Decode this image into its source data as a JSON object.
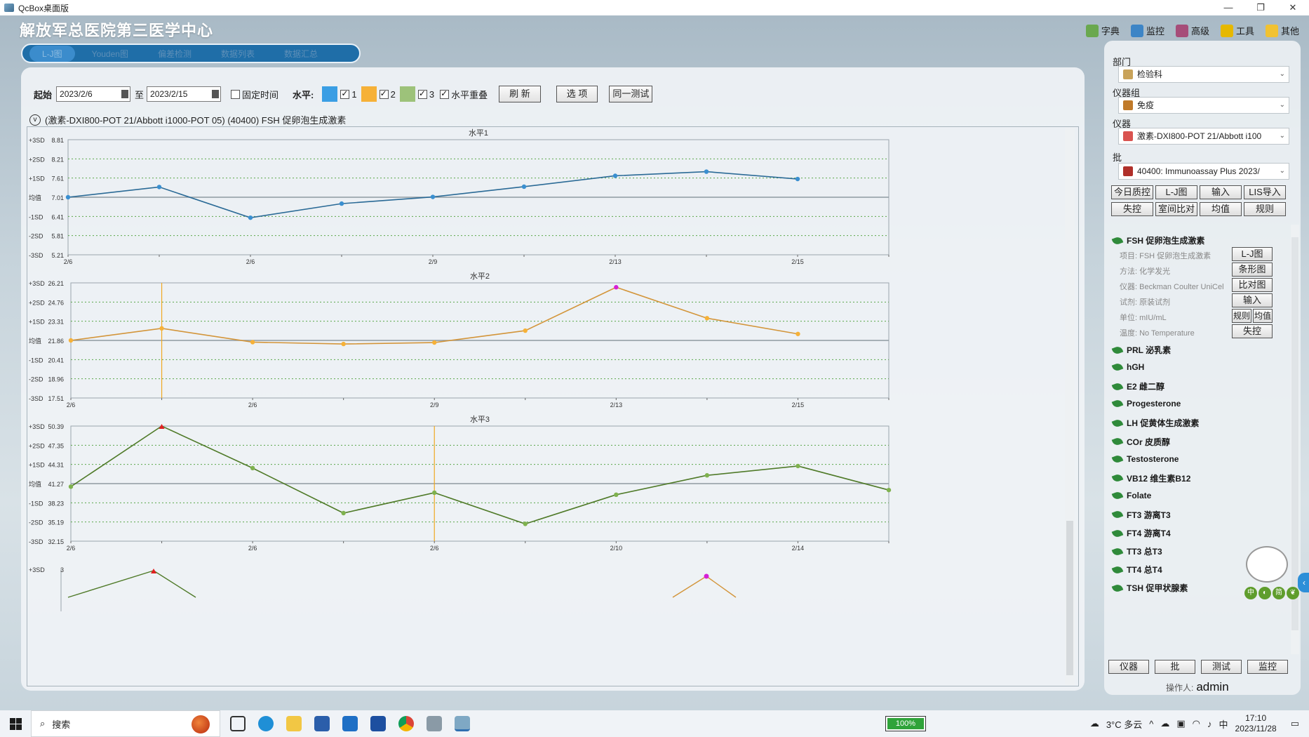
{
  "window": {
    "title": "QcBox桌面版",
    "controls": [
      "—",
      "❐",
      "✕"
    ]
  },
  "header": {
    "hospital": "解放军总医院第三医学中心",
    "tools": [
      {
        "label": "字典",
        "icon": "dictionary-icon",
        "color": "#6aa84f"
      },
      {
        "label": "监控",
        "icon": "monitor-icon",
        "color": "#3d85c6"
      },
      {
        "label": "高级",
        "icon": "advanced-icon",
        "color": "#a64d79"
      },
      {
        "label": "工具",
        "icon": "tools-icon",
        "color": "#e6b800"
      },
      {
        "label": "其他",
        "icon": "other-icon",
        "color": "#f1c232"
      }
    ],
    "nav_tabs": [
      "L-J图",
      "Youden图",
      "偏差检测",
      "数据列表",
      "数据汇总"
    ]
  },
  "filter": {
    "start_label": "起始",
    "start_date": "2023/2/6",
    "to_label": "至",
    "end_date": "2023/2/15",
    "fixed_time_label": "固定时间",
    "fixed_time_checked": false,
    "level_label": "水平:",
    "levels": [
      {
        "label": "1",
        "color": "#3a9ee4",
        "checked": true
      },
      {
        "label": "2",
        "color": "#f6b138",
        "checked": true
      },
      {
        "label": "3",
        "color": "#9dc27a",
        "checked": true
      }
    ],
    "overlap_label": "水平重叠",
    "overlap_checked": true,
    "refresh_label": "刷 新",
    "options_label": "选 项",
    "same_test_label": "同一测试"
  },
  "chart_header": {
    "toggle": "v",
    "text": "(激素-DXI800-POT 21/Abbott i1000-POT 05)  (40400)  FSH 促卵泡生成激素"
  },
  "chart_data": [
    {
      "type": "line",
      "title": "水平1",
      "color": "#2a6a96",
      "sd_labels": [
        "+3SD",
        "+2SD",
        "+1SD",
        "均值",
        "-1SD",
        "-2SD",
        "-3SD"
      ],
      "y_ticks": [
        "8.81",
        "8.21",
        "7.61",
        "7.01",
        "6.41",
        "5.81",
        "5.21"
      ],
      "ylim": [
        5.21,
        8.81
      ],
      "x_labels": [
        "2/6",
        "2/6",
        "2/9",
        "2/13",
        "2/15"
      ],
      "values": [
        7.01,
        7.33,
        6.37,
        6.81,
        7.02,
        7.34,
        7.68,
        7.81,
        7.58
      ],
      "highlights": []
    },
    {
      "type": "line",
      "title": "水平2",
      "color": "#d3953a",
      "sd_labels": [
        "+3SD",
        "+2SD",
        "+1SD",
        "均值",
        "-1SD",
        "-2SD",
        "-3SD"
      ],
      "y_ticks": [
        "26.21",
        "24.76",
        "23.31",
        "21.86",
        "20.41",
        "18.96",
        "17.51"
      ],
      "ylim": [
        17.51,
        26.21
      ],
      "x_labels": [
        "2/6",
        "2/6",
        "2/9",
        "2/13",
        "2/15"
      ],
      "values": [
        21.86,
        22.77,
        21.73,
        21.59,
        21.7,
        22.6,
        25.88,
        23.54,
        22.35
      ],
      "highlights": [
        6
      ],
      "cursor_index": 1
    },
    {
      "type": "line",
      "title": "水平3",
      "color": "#4f7a28",
      "sd_labels": [
        "+3SD",
        "+2SD",
        "+1SD",
        "均值",
        "-1SD",
        "-2SD",
        "-3SD"
      ],
      "y_ticks": [
        "50.39",
        "47.35",
        "44.31",
        "41.27",
        "38.23",
        "35.19",
        "32.15"
      ],
      "ylim": [
        32.15,
        50.39
      ],
      "x_labels": [
        "2/6",
        "2/6",
        "2/6",
        "2/10",
        "2/14"
      ],
      "values": [
        40.79,
        50.39,
        43.73,
        36.6,
        39.83,
        34.89,
        39.51,
        42.58,
        44.06,
        40.25
      ],
      "highlights": [
        1
      ],
      "cursor_index": 4
    },
    {
      "type": "line",
      "title": "",
      "sd_labels": [
        "+3SD"
      ],
      "y_ticks": [
        "3"
      ],
      "partial": true
    }
  ],
  "sidebar": {
    "department_label": "部门",
    "department_value": "检验科",
    "group_label": "仪器组",
    "group_value": "免疫",
    "instrument_label": "仪器",
    "instrument_value": "激素-DXI800-POT 21/Abbott i100",
    "batch_label": "批",
    "batch_value": "40400: Immunoassay Plus 2023/",
    "buttons": [
      "今日质控",
      "L-J图",
      "输入",
      "LIS导入",
      "失控",
      "室间比对",
      "均值",
      "规则"
    ],
    "selected_item": {
      "name": "FSH 促卵泡生成激素",
      "details": [
        "项目: FSH 促卵泡生成激素",
        "方法: 化学发光",
        "仪器: Beckman Coulter UniCel",
        "试剂: 原装试剂",
        "单位: mIU/mL",
        "温度: No Temperature"
      ],
      "actions": [
        "L-J图",
        "条形图",
        "比对图",
        "输入",
        "规则",
        "均值",
        "失控"
      ]
    },
    "items": [
      "PRL 泌乳素",
      "hGH",
      "E2 雌二醇",
      "Progesterone",
      "LH 促黄体生成激素",
      "COr 皮质醇",
      "Testosterone",
      "VB12 维生素B12",
      "Folate",
      "FT3 游离T3",
      "FT4 游离T4",
      "TT3 总T3",
      "TT4 总T4",
      "TSH 促甲状腺素"
    ],
    "bottom_buttons": [
      "仪器",
      "批",
      "测试",
      "监控"
    ],
    "operator_label": "操作人:",
    "operator_value": "admin",
    "mascot_badges": [
      "中",
      "◐",
      "简",
      "❦"
    ],
    "collapse_glyph": "‹"
  },
  "taskbar": {
    "search_placeholder": "搜索",
    "battery": "100%",
    "weather": "3°C  多云",
    "time": "17:10",
    "date": "2023/11/28"
  }
}
